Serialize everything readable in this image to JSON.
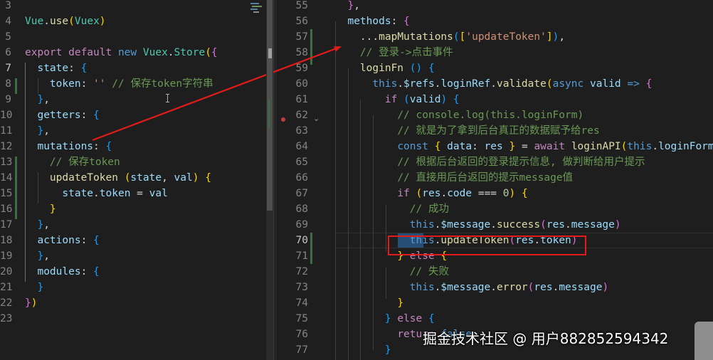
{
  "left_editor": {
    "lines": [
      {
        "n": "3",
        "tokens": []
      },
      {
        "n": "4",
        "tokens": [
          {
            "t": "Vue",
            "c": "cls"
          },
          {
            "t": ".",
            "c": "plain"
          },
          {
            "t": "use",
            "c": "func"
          },
          {
            "t": "(",
            "c": "br1"
          },
          {
            "t": "Vuex",
            "c": "cls"
          },
          {
            "t": ")",
            "c": "br1"
          }
        ]
      },
      {
        "n": "5",
        "tokens": []
      },
      {
        "n": "6",
        "tokens": [
          {
            "t": "export default ",
            "c": "ctl"
          },
          {
            "t": "new ",
            "c": "kw"
          },
          {
            "t": "Vuex",
            "c": "cls"
          },
          {
            "t": ".",
            "c": "plain"
          },
          {
            "t": "Store",
            "c": "cls"
          },
          {
            "t": "(",
            "c": "br1"
          },
          {
            "t": "{",
            "c": "br2"
          }
        ]
      },
      {
        "n": "7",
        "tokens": [
          {
            "t": "  ",
            "c": "plain"
          },
          {
            "t": "state",
            "c": "ident"
          },
          {
            "t": ": ",
            "c": "plain"
          },
          {
            "t": "{",
            "c": "br3"
          }
        ]
      },
      {
        "n": "8",
        "tokens": [
          {
            "t": "    ",
            "c": "plain"
          },
          {
            "t": "token",
            "c": "ident"
          },
          {
            "t": ": ",
            "c": "plain"
          },
          {
            "t": "''",
            "c": "str"
          },
          {
            "t": " ",
            "c": "plain"
          },
          {
            "t": "// 保存token字符串",
            "c": "com"
          }
        ]
      },
      {
        "n": "9",
        "tokens": [
          {
            "t": "  ",
            "c": "plain"
          },
          {
            "t": "}",
            "c": "br3"
          },
          {
            "t": ",",
            "c": "plain"
          }
        ]
      },
      {
        "n": "10",
        "tokens": [
          {
            "t": "  ",
            "c": "plain"
          },
          {
            "t": "getters",
            "c": "ident"
          },
          {
            "t": ": ",
            "c": "plain"
          },
          {
            "t": "{",
            "c": "br3"
          }
        ]
      },
      {
        "n": "11",
        "tokens": [
          {
            "t": "  ",
            "c": "plain"
          },
          {
            "t": "}",
            "c": "br3"
          },
          {
            "t": ",",
            "c": "plain"
          }
        ]
      },
      {
        "n": "12",
        "tokens": [
          {
            "t": "  ",
            "c": "plain"
          },
          {
            "t": "mutations",
            "c": "ident"
          },
          {
            "t": ": ",
            "c": "plain"
          },
          {
            "t": "{",
            "c": "br3"
          }
        ]
      },
      {
        "n": "13",
        "tokens": [
          {
            "t": "    ",
            "c": "plain"
          },
          {
            "t": "// 保存token",
            "c": "com"
          }
        ]
      },
      {
        "n": "14",
        "tokens": [
          {
            "t": "    ",
            "c": "plain"
          },
          {
            "t": "updateToken",
            "c": "func"
          },
          {
            "t": " ",
            "c": "plain"
          },
          {
            "t": "(",
            "c": "br1"
          },
          {
            "t": "state",
            "c": "ident"
          },
          {
            "t": ", ",
            "c": "plain"
          },
          {
            "t": "val",
            "c": "ident"
          },
          {
            "t": ")",
            "c": "br1"
          },
          {
            "t": " ",
            "c": "plain"
          },
          {
            "t": "{",
            "c": "br1"
          }
        ]
      },
      {
        "n": "15",
        "tokens": [
          {
            "t": "      ",
            "c": "plain"
          },
          {
            "t": "state",
            "c": "ident"
          },
          {
            "t": ".",
            "c": "plain"
          },
          {
            "t": "token",
            "c": "ident"
          },
          {
            "t": " = ",
            "c": "plain"
          },
          {
            "t": "val",
            "c": "ident"
          }
        ]
      },
      {
        "n": "16",
        "tokens": [
          {
            "t": "    ",
            "c": "plain"
          },
          {
            "t": "}",
            "c": "br1"
          }
        ]
      },
      {
        "n": "17",
        "tokens": [
          {
            "t": "  ",
            "c": "plain"
          },
          {
            "t": "}",
            "c": "br3"
          },
          {
            "t": ",",
            "c": "plain"
          }
        ]
      },
      {
        "n": "18",
        "tokens": [
          {
            "t": "  ",
            "c": "plain"
          },
          {
            "t": "actions",
            "c": "ident"
          },
          {
            "t": ": ",
            "c": "plain"
          },
          {
            "t": "{",
            "c": "br3"
          }
        ]
      },
      {
        "n": "19",
        "tokens": [
          {
            "t": "  ",
            "c": "plain"
          },
          {
            "t": "}",
            "c": "br3"
          },
          {
            "t": ",",
            "c": "plain"
          }
        ]
      },
      {
        "n": "20",
        "tokens": [
          {
            "t": "  ",
            "c": "plain"
          },
          {
            "t": "modules",
            "c": "ident"
          },
          {
            "t": ": ",
            "c": "plain"
          },
          {
            "t": "{",
            "c": "br3"
          }
        ]
      },
      {
        "n": "21",
        "tokens": [
          {
            "t": "  ",
            "c": "plain"
          },
          {
            "t": "}",
            "c": "br3"
          }
        ]
      },
      {
        "n": "22",
        "tokens": [
          {
            "t": "}",
            "c": "br2"
          },
          {
            "t": ")",
            "c": "br1"
          }
        ]
      },
      {
        "n": "23",
        "tokens": []
      }
    ]
  },
  "right_editor": {
    "current_line": "70",
    "lines": [
      {
        "n": "55",
        "tokens": [
          {
            "t": "  ",
            "c": "plain"
          },
          {
            "t": "}",
            "c": "br2"
          },
          {
            "t": ",",
            "c": "plain"
          }
        ]
      },
      {
        "n": "56",
        "tokens": [
          {
            "t": "  ",
            "c": "plain"
          },
          {
            "t": "methods",
            "c": "ident"
          },
          {
            "t": ": ",
            "c": "plain"
          },
          {
            "t": "{",
            "c": "br2"
          }
        ]
      },
      {
        "n": "57",
        "tokens": [
          {
            "t": "    ",
            "c": "plain"
          },
          {
            "t": "...",
            "c": "plain"
          },
          {
            "t": "mapMutations",
            "c": "func"
          },
          {
            "t": "(",
            "c": "br3"
          },
          {
            "t": "[",
            "c": "br1"
          },
          {
            "t": "'updateToken'",
            "c": "str"
          },
          {
            "t": "]",
            "c": "br1"
          },
          {
            "t": ")",
            "c": "br3"
          },
          {
            "t": ",",
            "c": "plain"
          }
        ]
      },
      {
        "n": "58",
        "tokens": [
          {
            "t": "    ",
            "c": "plain"
          },
          {
            "t": "// 登录->点击事件",
            "c": "com"
          }
        ]
      },
      {
        "n": "59",
        "tokens": [
          {
            "t": "    ",
            "c": "plain"
          },
          {
            "t": "loginFn",
            "c": "func"
          },
          {
            "t": " ",
            "c": "plain"
          },
          {
            "t": "()",
            "c": "br3"
          },
          {
            "t": " ",
            "c": "plain"
          },
          {
            "t": "{",
            "c": "br3"
          }
        ]
      },
      {
        "n": "60",
        "tokens": [
          {
            "t": "      ",
            "c": "plain"
          },
          {
            "t": "this",
            "c": "kw"
          },
          {
            "t": ".",
            "c": "plain"
          },
          {
            "t": "$refs",
            "c": "ident"
          },
          {
            "t": ".",
            "c": "plain"
          },
          {
            "t": "loginRef",
            "c": "ident"
          },
          {
            "t": ".",
            "c": "plain"
          },
          {
            "t": "validate",
            "c": "func"
          },
          {
            "t": "(",
            "c": "br1"
          },
          {
            "t": "async ",
            "c": "kw"
          },
          {
            "t": "valid",
            "c": "ident"
          },
          {
            "t": " ",
            "c": "plain"
          },
          {
            "t": "=>",
            "c": "kw"
          },
          {
            "t": " ",
            "c": "plain"
          },
          {
            "t": "{",
            "c": "br2"
          }
        ]
      },
      {
        "n": "61",
        "tokens": [
          {
            "t": "        ",
            "c": "plain"
          },
          {
            "t": "if",
            "c": "ctl"
          },
          {
            "t": " ",
            "c": "plain"
          },
          {
            "t": "(",
            "c": "br3"
          },
          {
            "t": "valid",
            "c": "ident"
          },
          {
            "t": ")",
            "c": "br3"
          },
          {
            "t": " ",
            "c": "plain"
          },
          {
            "t": "{",
            "c": "br3"
          }
        ]
      },
      {
        "n": "62",
        "tokens": [
          {
            "t": "          ",
            "c": "plain"
          },
          {
            "t": "// console.log(this.loginForm)",
            "c": "com"
          }
        ]
      },
      {
        "n": "63",
        "tokens": [
          {
            "t": "          ",
            "c": "plain"
          },
          {
            "t": "// 就是为了拿到后台真正的数据赋予给res",
            "c": "com"
          }
        ]
      },
      {
        "n": "64",
        "tokens": [
          {
            "t": "          ",
            "c": "plain"
          },
          {
            "t": "const",
            "c": "kw"
          },
          {
            "t": " ",
            "c": "plain"
          },
          {
            "t": "{",
            "c": "br1"
          },
          {
            "t": " ",
            "c": "plain"
          },
          {
            "t": "data",
            "c": "ident"
          },
          {
            "t": ": ",
            "c": "plain"
          },
          {
            "t": "res",
            "c": "ident"
          },
          {
            "t": " ",
            "c": "plain"
          },
          {
            "t": "}",
            "c": "br1"
          },
          {
            "t": " = ",
            "c": "plain"
          },
          {
            "t": "await",
            "c": "ctl"
          },
          {
            "t": " ",
            "c": "plain"
          },
          {
            "t": "loginAPI",
            "c": "func"
          },
          {
            "t": "(",
            "c": "br1"
          },
          {
            "t": "this",
            "c": "kw"
          },
          {
            "t": ".",
            "c": "plain"
          },
          {
            "t": "loginForm",
            "c": "ident"
          },
          {
            "t": ")",
            "c": "br1"
          }
        ]
      },
      {
        "n": "65",
        "tokens": [
          {
            "t": "          ",
            "c": "plain"
          },
          {
            "t": "// 根据后台返回的登录提示信息, 做判断给用户提示",
            "c": "com"
          }
        ]
      },
      {
        "n": "66",
        "tokens": [
          {
            "t": "          ",
            "c": "plain"
          },
          {
            "t": "// 直接用后台返回的提示message值",
            "c": "com"
          }
        ]
      },
      {
        "n": "67",
        "tokens": [
          {
            "t": "          ",
            "c": "plain"
          },
          {
            "t": "if",
            "c": "ctl"
          },
          {
            "t": " ",
            "c": "plain"
          },
          {
            "t": "(",
            "c": "br1"
          },
          {
            "t": "res",
            "c": "ident"
          },
          {
            "t": ".",
            "c": "plain"
          },
          {
            "t": "code",
            "c": "ident"
          },
          {
            "t": " === ",
            "c": "plain"
          },
          {
            "t": "0",
            "c": "num"
          },
          {
            "t": ")",
            "c": "br1"
          },
          {
            "t": " ",
            "c": "plain"
          },
          {
            "t": "{",
            "c": "br1"
          }
        ]
      },
      {
        "n": "68",
        "tokens": [
          {
            "t": "            ",
            "c": "plain"
          },
          {
            "t": "// 成功",
            "c": "com"
          }
        ]
      },
      {
        "n": "69",
        "tokens": [
          {
            "t": "            ",
            "c": "plain"
          },
          {
            "t": "this",
            "c": "kw"
          },
          {
            "t": ".",
            "c": "plain"
          },
          {
            "t": "$message",
            "c": "ident"
          },
          {
            "t": ".",
            "c": "plain"
          },
          {
            "t": "success",
            "c": "func"
          },
          {
            "t": "(",
            "c": "br2"
          },
          {
            "t": "res",
            "c": "ident"
          },
          {
            "t": ".",
            "c": "plain"
          },
          {
            "t": "message",
            "c": "ident"
          },
          {
            "t": ")",
            "c": "br2"
          }
        ]
      },
      {
        "n": "70",
        "tokens": [
          {
            "t": "            ",
            "c": "plain"
          },
          {
            "t": "this",
            "c": "kw"
          },
          {
            "t": ".",
            "c": "plain"
          },
          {
            "t": "updateToken",
            "c": "func"
          },
          {
            "t": "(",
            "c": "br2"
          },
          {
            "t": "res",
            "c": "ident"
          },
          {
            "t": ".",
            "c": "plain"
          },
          {
            "t": "token",
            "c": "ident"
          },
          {
            "t": ")",
            "c": "br2"
          }
        ]
      },
      {
        "n": "71",
        "tokens": [
          {
            "t": "          ",
            "c": "plain"
          },
          {
            "t": "}",
            "c": "br1"
          },
          {
            "t": " ",
            "c": "plain"
          },
          {
            "t": "else",
            "c": "ctl"
          },
          {
            "t": " ",
            "c": "plain"
          },
          {
            "t": "{",
            "c": "br1"
          }
        ]
      },
      {
        "n": "72",
        "tokens": [
          {
            "t": "            ",
            "c": "plain"
          },
          {
            "t": "// 失败",
            "c": "com"
          }
        ]
      },
      {
        "n": "73",
        "tokens": [
          {
            "t": "            ",
            "c": "plain"
          },
          {
            "t": "this",
            "c": "kw"
          },
          {
            "t": ".",
            "c": "plain"
          },
          {
            "t": "$message",
            "c": "ident"
          },
          {
            "t": ".",
            "c": "plain"
          },
          {
            "t": "error",
            "c": "func"
          },
          {
            "t": "(",
            "c": "br2"
          },
          {
            "t": "res",
            "c": "ident"
          },
          {
            "t": ".",
            "c": "plain"
          },
          {
            "t": "message",
            "c": "ident"
          },
          {
            "t": ")",
            "c": "br2"
          }
        ]
      },
      {
        "n": "74",
        "tokens": [
          {
            "t": "          ",
            "c": "plain"
          },
          {
            "t": "}",
            "c": "br1"
          }
        ]
      },
      {
        "n": "75",
        "tokens": [
          {
            "t": "        ",
            "c": "plain"
          },
          {
            "t": "}",
            "c": "br3"
          },
          {
            "t": " ",
            "c": "plain"
          },
          {
            "t": "else",
            "c": "ctl"
          },
          {
            "t": " ",
            "c": "plain"
          },
          {
            "t": "{",
            "c": "br3"
          }
        ]
      },
      {
        "n": "76",
        "tokens": [
          {
            "t": "          ",
            "c": "plain"
          },
          {
            "t": "return",
            "c": "ctl"
          },
          {
            "t": " ",
            "c": "plain"
          },
          {
            "t": "false",
            "c": "kw"
          }
        ]
      },
      {
        "n": "77",
        "tokens": [
          {
            "t": "        ",
            "c": "plain"
          },
          {
            "t": "}",
            "c": "br3"
          }
        ]
      }
    ]
  },
  "watermark": "掘金技术社区 @ 用户882852594342",
  "colors": {
    "background": "#1e1e1e",
    "annotation": "#e31b1b",
    "selection": "#264f78",
    "line_number": "#858585"
  },
  "icons": [
    "breakpoint-icon",
    "fold-chevron-icon",
    "text-cursor-icon"
  ]
}
